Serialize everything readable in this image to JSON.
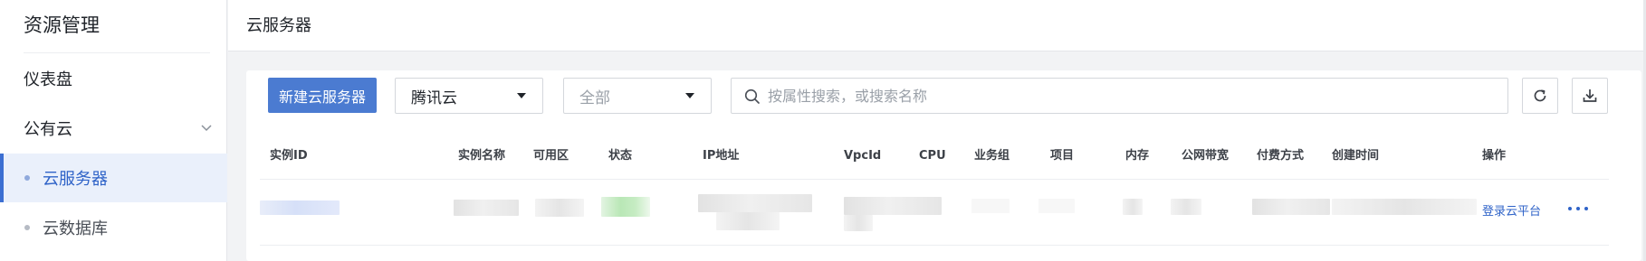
{
  "sidebar": {
    "title": "资源管理",
    "items": [
      {
        "label": "仪表盘"
      },
      {
        "label": "公有云"
      },
      {
        "label": "云服务器"
      },
      {
        "label": "云数据库"
      }
    ]
  },
  "header": {
    "title": "云服务器"
  },
  "toolbar": {
    "create_label": "新建云服务器",
    "provider_select": "腾讯云",
    "status_select": "全部",
    "search_placeholder": "按属性搜索，或搜索名称",
    "search_value": ""
  },
  "table": {
    "columns": [
      "实例ID",
      "实例名称",
      "可用区",
      "状态",
      "IP地址",
      "VpcId",
      "CPU",
      "业务组",
      "项目",
      "内存",
      "公网带宽",
      "付费方式",
      "创建时间",
      "操作"
    ],
    "rows": [
      {
        "action_link": "登录云平台"
      }
    ]
  },
  "colors": {
    "accent": "#4b7bd1",
    "link": "#2f63c8",
    "active_bg": "#eaf0fb"
  },
  "icons": [
    "chevron-down-icon",
    "search-icon",
    "refresh-icon",
    "download-icon",
    "more-icon"
  ]
}
